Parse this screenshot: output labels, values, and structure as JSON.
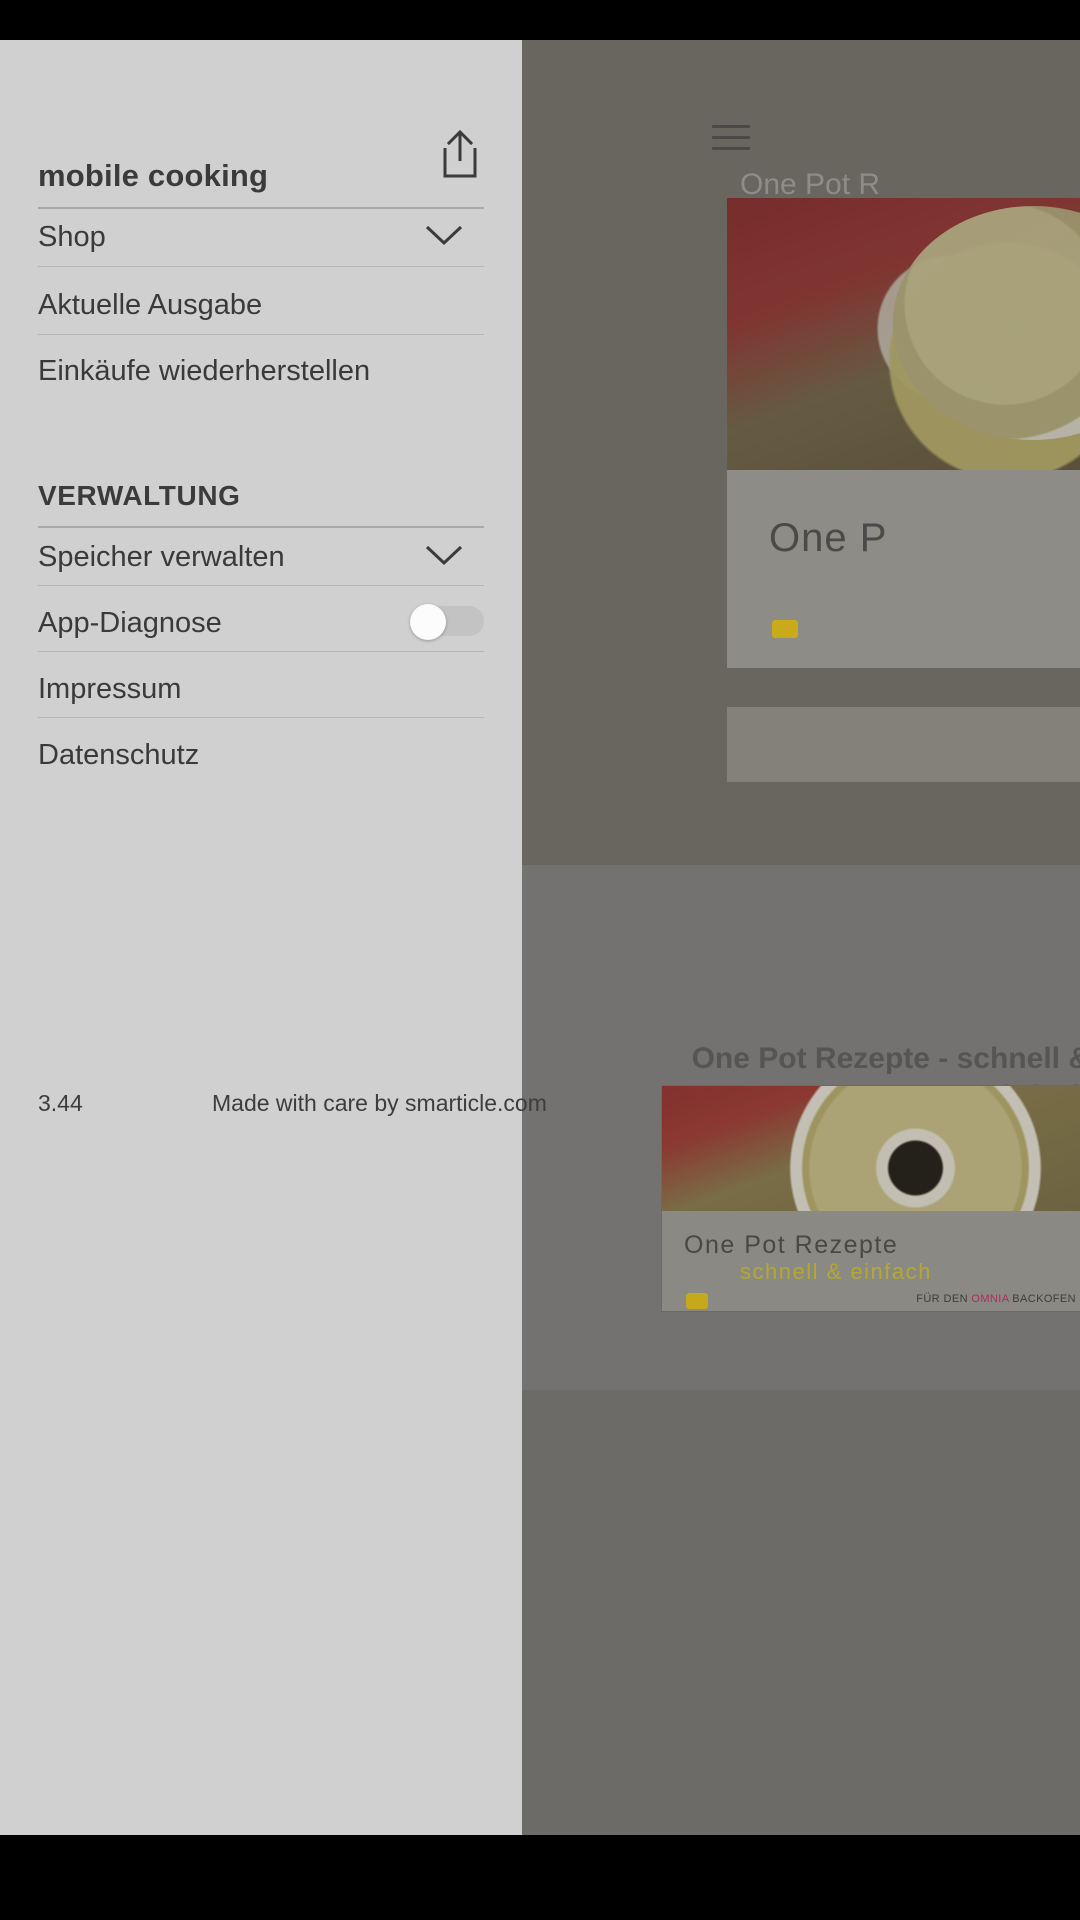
{
  "drawer": {
    "title": "mobile cooking",
    "share_icon": "share-icon",
    "primary_items": [
      {
        "label": "Shop",
        "accessory": "chevron-down-icon"
      },
      {
        "label": "Aktuelle Ausgabe",
        "accessory": "none"
      },
      {
        "label": "Einkäufe wiederherstellen",
        "accessory": "none"
      }
    ],
    "section_label": "VERWALTUNG",
    "admin_items": [
      {
        "label": "Speicher verwalten",
        "accessory": "chevron-down-icon"
      },
      {
        "label": "App-Diagnose",
        "accessory": "toggle",
        "toggle_on": false
      },
      {
        "label": "Impressum",
        "accessory": "none"
      },
      {
        "label": "Datenschutz",
        "accessory": "none"
      }
    ],
    "footer": {
      "version": "3.44",
      "credit": "Made with care by smarticle.com"
    }
  },
  "background_app": {
    "menu_icon": "hamburger-menu-icon",
    "top_heading": "One Pot R",
    "top_card": {
      "title": "One P",
      "badge_color": "#c9aa18"
    },
    "lower_heading": "One Pot Rezepte -\nschnell & einfach",
    "lower_card": {
      "title": "One Pot Rezepte",
      "subtitle": "schnell & einfach",
      "tag_prefix": "FÜR DEN ",
      "tag_brand": "OMNIA",
      "tag_suffix": " BACKOFEN"
    }
  },
  "colors": {
    "drawer_bg": "#d0d0d0",
    "overlay_dim": "#6f6d6a",
    "text_primary": "#3a3a3a",
    "divider": "#a9a9a9",
    "brand_omnia": "#b0295f",
    "accent_yellow": "#b4a930",
    "status_bar": "#000000"
  }
}
